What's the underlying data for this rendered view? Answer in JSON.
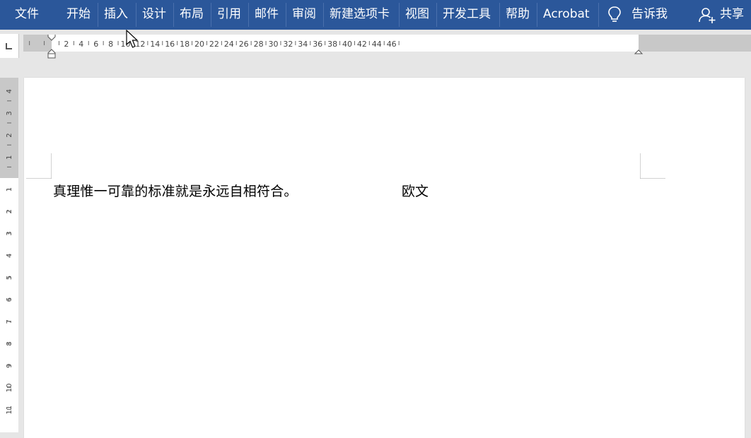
{
  "menubar": {
    "tabs": [
      {
        "id": "file",
        "label": "文件"
      },
      {
        "id": "home",
        "label": "开始"
      },
      {
        "id": "insert",
        "label": "插入"
      },
      {
        "id": "design",
        "label": "设计"
      },
      {
        "id": "layout",
        "label": "布局"
      },
      {
        "id": "references",
        "label": "引用"
      },
      {
        "id": "mailings",
        "label": "邮件"
      },
      {
        "id": "review",
        "label": "审阅"
      },
      {
        "id": "newtab",
        "label": "新建选项卡"
      },
      {
        "id": "view",
        "label": "视图"
      },
      {
        "id": "developer",
        "label": "开发工具"
      },
      {
        "id": "help",
        "label": "帮助"
      },
      {
        "id": "acrobat",
        "label": "Acrobat"
      }
    ],
    "tell_me": "告诉我",
    "share": "共享",
    "background_color": "#2b579a"
  },
  "hruler": {
    "labels": [
      "2",
      "4",
      "6",
      "8",
      "10",
      "12",
      "14",
      "16",
      "18",
      "20",
      "22",
      "24",
      "26",
      "28",
      "30",
      "32",
      "34",
      "36",
      "38",
      "40",
      "42",
      "44",
      "46"
    ]
  },
  "vruler": {
    "top_labels": [
      "4",
      "3",
      "2",
      "1"
    ],
    "body_labels": [
      "1",
      "2",
      "3",
      "4",
      "5",
      "6",
      "7",
      "8",
      "9",
      "10",
      "11"
    ]
  },
  "document": {
    "line_text": "真理惟一可靠的标准就是永远自相符合。",
    "word": "欧文"
  }
}
